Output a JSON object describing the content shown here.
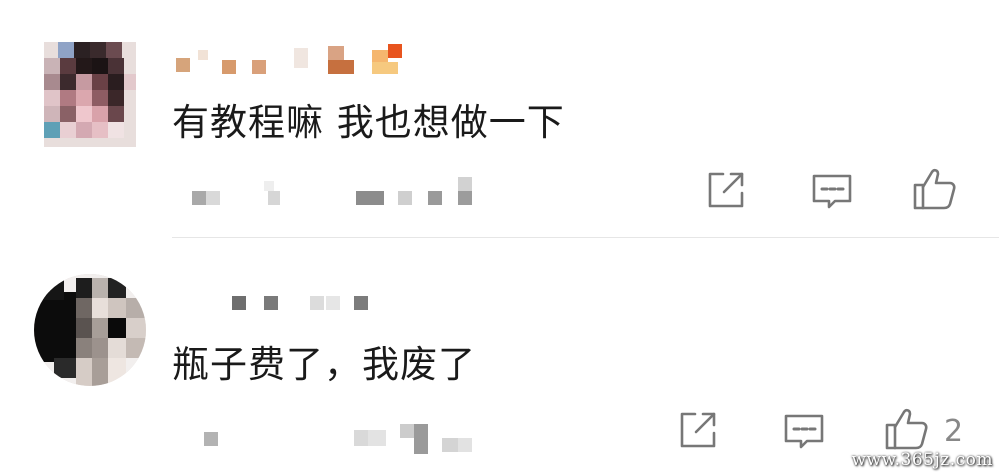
{
  "comments": [
    {
      "text": "有教程嘛 我也想做一下",
      "actions": {
        "share": "share-icon",
        "reply": "comment-icon",
        "like": "thumbs-up-icon"
      },
      "like_count": ""
    },
    {
      "text": "瓶子费了，我废了",
      "actions": {
        "share": "share-icon",
        "reply": "comment-icon",
        "like": "thumbs-up-icon"
      },
      "like_count": "2"
    }
  ],
  "watermark": "www.365jz.com",
  "colors": {
    "text": "#1a1a1a",
    "icon": "#777777",
    "divider": "#e6e6e6",
    "like_count": "#888888"
  }
}
